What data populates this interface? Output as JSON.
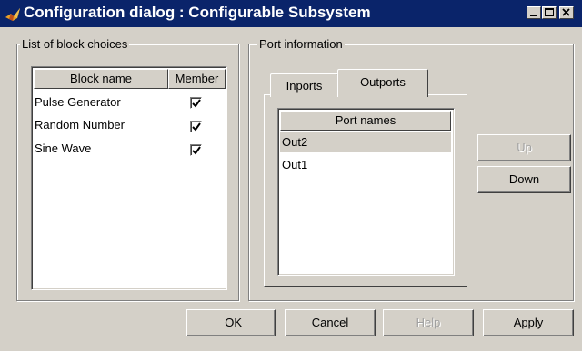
{
  "window": {
    "title": "Configuration dialog : Configurable Subsystem",
    "controls": {
      "minimize_icon": "minimize-icon",
      "maximize_icon": "maximize-icon",
      "close_icon": "close-icon"
    }
  },
  "block_choices": {
    "label": "List of block choices",
    "columns": [
      "Block name",
      "Member"
    ],
    "rows": [
      {
        "name": "Pulse Generator",
        "member": true
      },
      {
        "name": "Random Number",
        "member": true
      },
      {
        "name": "Sine Wave",
        "member": true
      }
    ]
  },
  "port_information": {
    "label": "Port information",
    "tabs": [
      {
        "label": "Inports",
        "active": false
      },
      {
        "label": "Outports",
        "active": true
      }
    ],
    "column": "Port names",
    "ports": [
      {
        "name": "Out2",
        "selected": true
      },
      {
        "name": "Out1",
        "selected": false
      }
    ],
    "up_label": "Up",
    "down_label": "Down"
  },
  "buttons": {
    "ok": "OK",
    "cancel": "Cancel",
    "help": "Help",
    "apply": "Apply"
  },
  "colors": {
    "titlebar": "#0a246a",
    "face": "#d4d0c8",
    "selection": "#d4d0c8"
  }
}
